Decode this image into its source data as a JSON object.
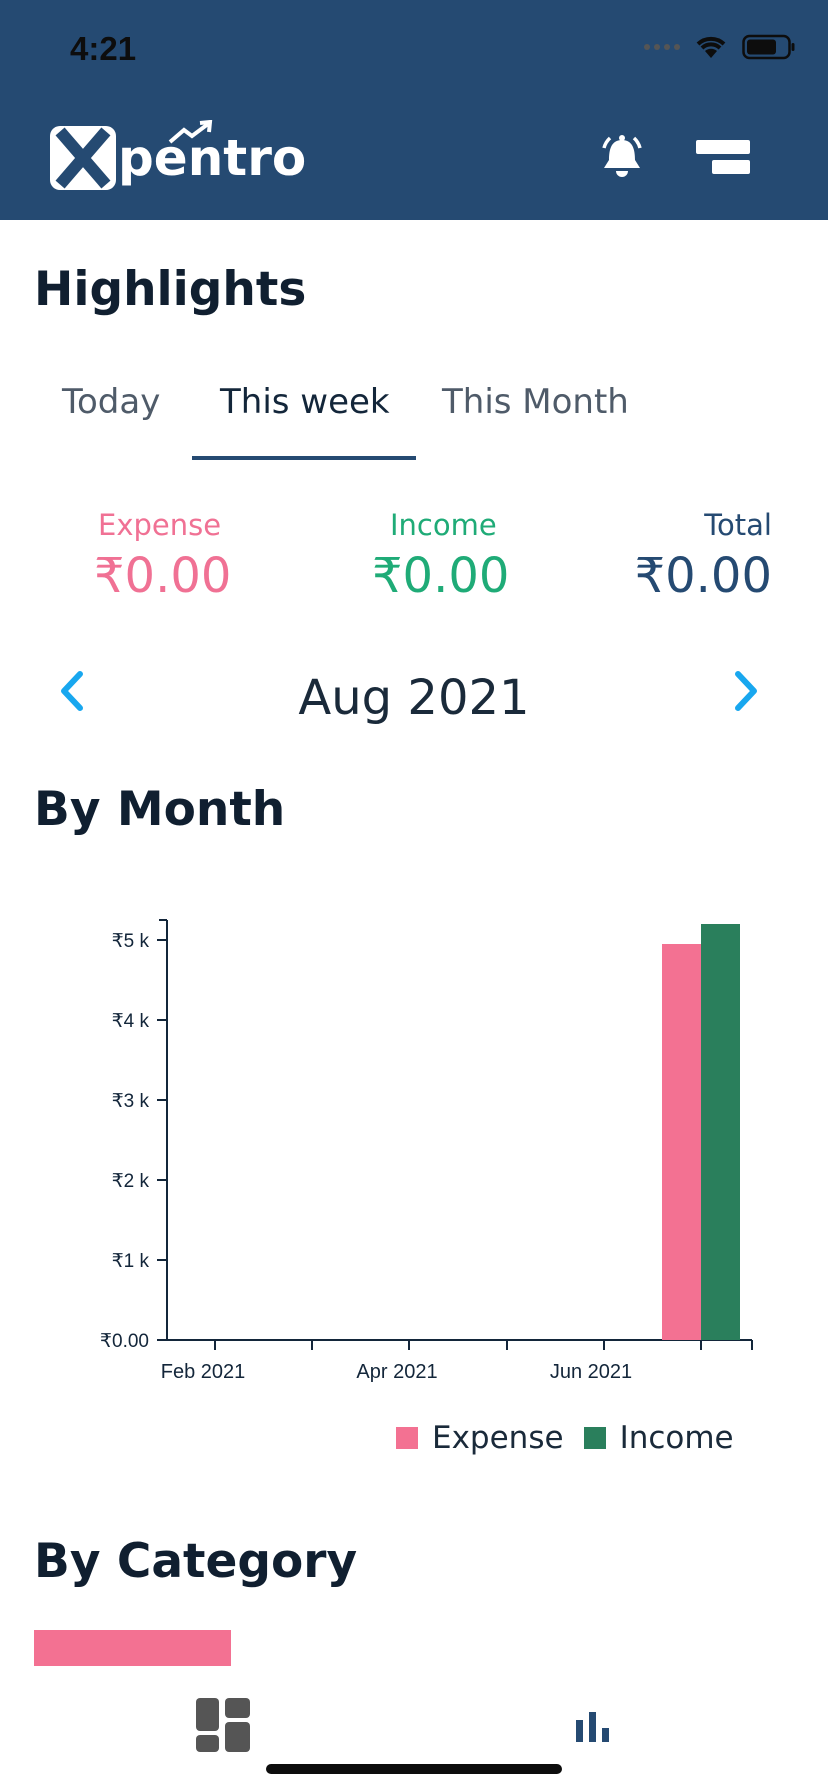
{
  "status_bar": {
    "time": "4:21"
  },
  "header": {
    "logo_text": "pentro",
    "background": "#254a72"
  },
  "highlights": {
    "title": "Highlights",
    "tabs": [
      {
        "label": "Today",
        "active": false
      },
      {
        "label": "This week",
        "active": true
      },
      {
        "label": "This Month",
        "active": false
      }
    ],
    "summary": {
      "expense": {
        "label": "Expense",
        "value": "₹0.00",
        "color": "#f07194"
      },
      "income": {
        "label": "Income",
        "value": "₹0.00",
        "color": "#1fab77"
      },
      "total": {
        "label": "Total",
        "value": "₹0.00",
        "color": "#254a72"
      }
    },
    "period": "Aug 2021"
  },
  "by_month": {
    "title": "By Month"
  },
  "chart_data": {
    "type": "bar",
    "title": "",
    "xlabel": "",
    "ylabel": "",
    "x_ticks": [
      "Feb 2021",
      "Apr 2021",
      "Jun 2021"
    ],
    "y_ticks": [
      "₹0.00",
      "₹1 k",
      "₹2 k",
      "₹3 k",
      "₹4 k",
      "₹5 k"
    ],
    "ylim": [
      0,
      5250
    ],
    "categories": [
      "Aug 2021"
    ],
    "series": [
      {
        "name": "Expense",
        "color": "#f37192",
        "values": [
          4950
        ]
      },
      {
        "name": "Income",
        "color": "#2a7f5c",
        "values": [
          5200
        ]
      }
    ],
    "grid": false,
    "legend": "bottom-right"
  },
  "by_category": {
    "title": "By Category",
    "bar_color": "#f37192"
  },
  "bottom_nav": {
    "icons": [
      "dashboard-icon",
      "bar-chart-icon"
    ]
  }
}
